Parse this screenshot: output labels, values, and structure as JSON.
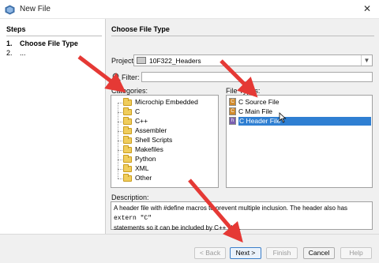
{
  "window": {
    "title": "New File",
    "close_glyph": "✕"
  },
  "steps": {
    "heading": "Steps",
    "items": [
      {
        "num": "1.",
        "label": "Choose File Type"
      },
      {
        "num": "2.",
        "label": "..."
      }
    ]
  },
  "panel": {
    "heading": "Choose File Type"
  },
  "project": {
    "label": "Project:",
    "value": "10F322_Headers",
    "icon": "project-chip-icon"
  },
  "filter": {
    "label": "Filter:",
    "value": ""
  },
  "categories": {
    "label": "Categories:",
    "items": [
      {
        "label": "Microchip Embedded",
        "depth": 0
      },
      {
        "label": "C",
        "depth": 0
      },
      {
        "label": "C++",
        "depth": 0
      },
      {
        "label": "Assembler",
        "depth": 0
      },
      {
        "label": "Shell Scripts",
        "depth": 0
      },
      {
        "label": "Makefiles",
        "depth": 0
      },
      {
        "label": "Python",
        "depth": 0
      },
      {
        "label": "XML",
        "depth": 0
      },
      {
        "label": "Other",
        "depth": 0
      }
    ]
  },
  "file_types": {
    "label": "File Types:",
    "items": [
      {
        "label": "C Source File",
        "selected": false
      },
      {
        "label": "C Main File",
        "selected": false
      },
      {
        "label": "C Header File",
        "selected": true
      }
    ]
  },
  "description": {
    "label": "Description:",
    "text_part1": "A header file with #define macros to prevent multiple inclusion. The header also has ",
    "code": "extern \"C\"",
    "text_part2": "statements so it can be included by C++ files."
  },
  "buttons": {
    "back": "< Back",
    "next": "Next >",
    "finish": "Finish",
    "cancel": "Cancel",
    "help": "Help"
  },
  "colors": {
    "selection": "#2f7fd2",
    "annotation_arrow": "#e53935",
    "folder": "#f0cd5c"
  }
}
